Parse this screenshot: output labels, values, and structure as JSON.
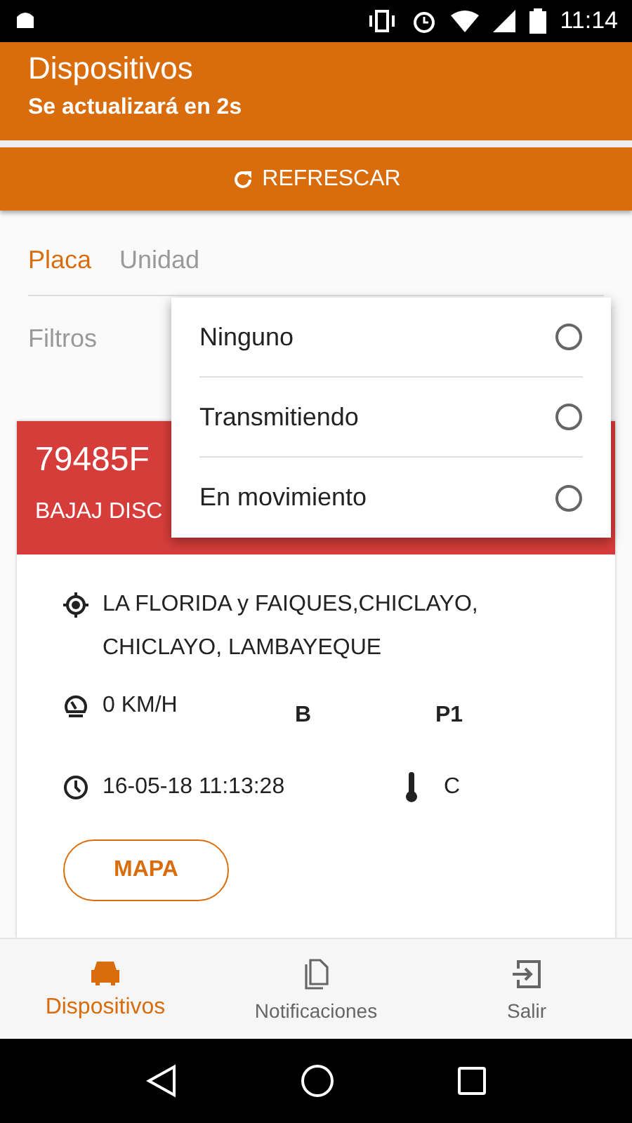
{
  "status_bar": {
    "time": "11:14"
  },
  "header": {
    "title": "Dispositivos",
    "subtitle": "Se actualizará en 2s"
  },
  "refresh_button": {
    "label": "REFRESCAR"
  },
  "tabs": [
    {
      "label": "Placa",
      "selected": true
    },
    {
      "label": "Unidad",
      "selected": false
    }
  ],
  "filters": {
    "label": "Filtros"
  },
  "filter_menu": [
    {
      "label": "Ninguno",
      "selected": false
    },
    {
      "label": "Transmitiendo",
      "selected": false
    },
    {
      "label": "En movimiento",
      "selected": false
    }
  ],
  "device": {
    "plate": "79485F",
    "model": "BAJAJ DISC",
    "address": "LA FLORIDA y FAIQUES,CHICLAYO, CHICLAYO, LAMBAYEQUE",
    "speed": "0 KM/H",
    "field_b": "B",
    "field_p": "P1",
    "datetime": "16-05-18 11:13:28",
    "temperature": "C",
    "map_button": "MAPA"
  },
  "bottom_nav": [
    {
      "label": "Dispositivos",
      "kind": "car",
      "selected": true
    },
    {
      "label": "Notificaciones",
      "kind": "document",
      "selected": false
    },
    {
      "label": "Salir",
      "kind": "exit",
      "selected": false
    }
  ]
}
